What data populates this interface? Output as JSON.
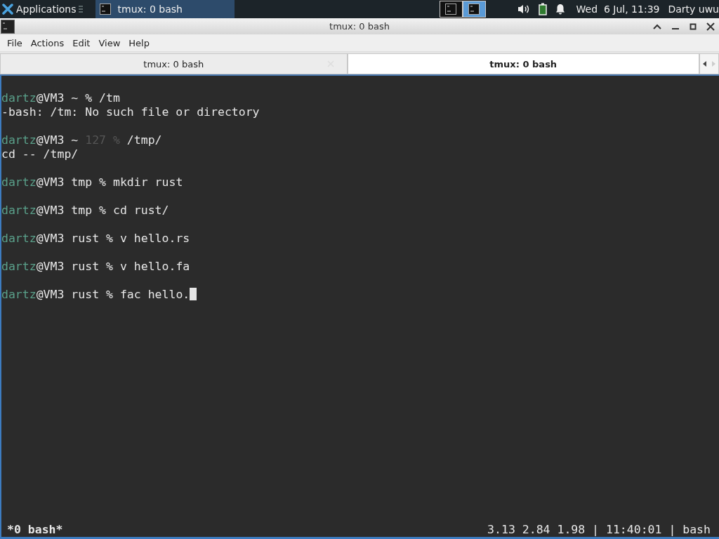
{
  "taskbar": {
    "apps_menu": "Applications",
    "tasks": [
      {
        "label": "tmux: 0 bash",
        "selected": true
      }
    ],
    "workspaces": [
      {
        "selected": false
      },
      {
        "selected": true
      }
    ],
    "clock": "Wed  6 Jul, 11:39",
    "user": "Darty uwu"
  },
  "window": {
    "title": "tmux: 0 bash"
  },
  "menu": [
    "File",
    "Actions",
    "Edit",
    "View",
    "Help"
  ],
  "tabs": [
    {
      "label": "tmux: 0 bash",
      "selected": false
    },
    {
      "label": "tmux: 0 bash",
      "selected": true
    }
  ],
  "terminal": {
    "lines": [
      {
        "kind": "prompt",
        "user": "dartz",
        "host": "@VM3",
        "cwd": "~",
        "symbol": "%",
        "command": "/tm"
      },
      {
        "kind": "output",
        "text": "-bash: /tm: No such file or directory"
      },
      {
        "kind": "prompt",
        "user": "dartz",
        "host": "@VM3",
        "cwd": "~",
        "status": "127",
        "symbol": "%",
        "command": "/tmp/"
      },
      {
        "kind": "output",
        "text": "cd -- /tmp/"
      },
      {
        "kind": "prompt",
        "user": "dartz",
        "host": "@VM3",
        "cwd": "tmp",
        "symbol": "%",
        "command": "mkdir rust"
      },
      {
        "kind": "prompt",
        "user": "dartz",
        "host": "@VM3",
        "cwd": "tmp",
        "symbol": "%",
        "command": "cd rust/"
      },
      {
        "kind": "prompt",
        "user": "dartz",
        "host": "@VM3",
        "cwd": "rust",
        "symbol": "%",
        "command": "v hello.rs"
      },
      {
        "kind": "prompt",
        "user": "dartz",
        "host": "@VM3",
        "cwd": "rust",
        "symbol": "%",
        "command": "v hello.fa"
      },
      {
        "kind": "prompt",
        "user": "dartz",
        "host": "@VM3",
        "cwd": "rust",
        "symbol": "%",
        "command": "fac hello.",
        "cursor": true
      }
    ]
  },
  "tmux_status": {
    "window": "*0 bash*",
    "right": "3.13 2.84 1.98 | 11:40:01 | bash"
  }
}
